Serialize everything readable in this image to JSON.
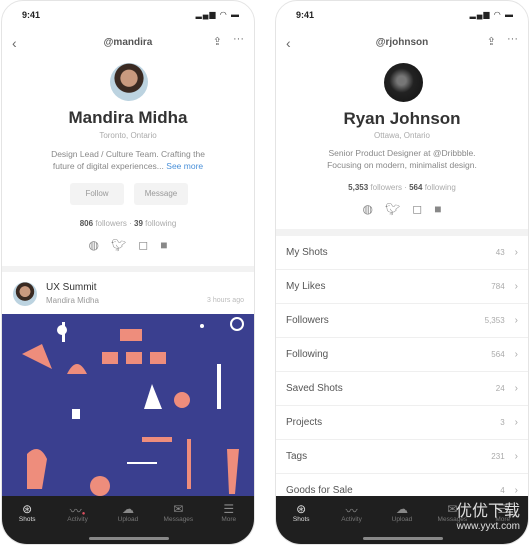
{
  "left": {
    "time": "9:41",
    "handle": "@mandira",
    "name": "Mandira Midha",
    "location": "Toronto, Ontario",
    "bio_line1": "Design Lead / Culture Team. Crafting the",
    "bio_line2": "future of digital experiences...",
    "see_more": "See more",
    "follow": "Follow",
    "message": "Message",
    "followers": "806",
    "followers_label": "followers",
    "following": "39",
    "following_label": "following",
    "post": {
      "title": "UX Summit",
      "author": "Mandira Midha",
      "time": "3 hours ago"
    },
    "shot_colors": {
      "background": "#3a3f8f",
      "accent": "#ee8d7c"
    }
  },
  "right": {
    "time": "9:41",
    "handle": "@rjohnson",
    "name": "Ryan Johnson",
    "location": "Ottawa, Ontario",
    "bio_line1": "Senior Product Designer at @Dribbble.",
    "bio_line2": "Focusing on modern, minimalist design.",
    "followers": "5,353",
    "followers_label": "followers",
    "following": "564",
    "following_label": "following",
    "rows": [
      {
        "label": "My Shots",
        "count": "43"
      },
      {
        "label": "My Likes",
        "count": "784"
      },
      {
        "label": "Followers",
        "count": "5,353"
      },
      {
        "label": "Following",
        "count": "564"
      },
      {
        "label": "Saved Shots",
        "count": "24"
      },
      {
        "label": "Projects",
        "count": "3"
      },
      {
        "label": "Tags",
        "count": "231"
      },
      {
        "label": "Goods for Sale",
        "count": "4"
      }
    ]
  },
  "tabs": [
    {
      "label": "Shots",
      "icon": "dribbble-ball-icon"
    },
    {
      "label": "Activity",
      "icon": "activity-icon"
    },
    {
      "label": "Upload",
      "icon": "upload-cloud-icon"
    },
    {
      "label": "Messages",
      "icon": "mail-icon"
    },
    {
      "label": "More",
      "icon": "menu-icon"
    }
  ],
  "watermark": {
    "line1": "优优下载",
    "line2": "www.yyxt.com"
  }
}
